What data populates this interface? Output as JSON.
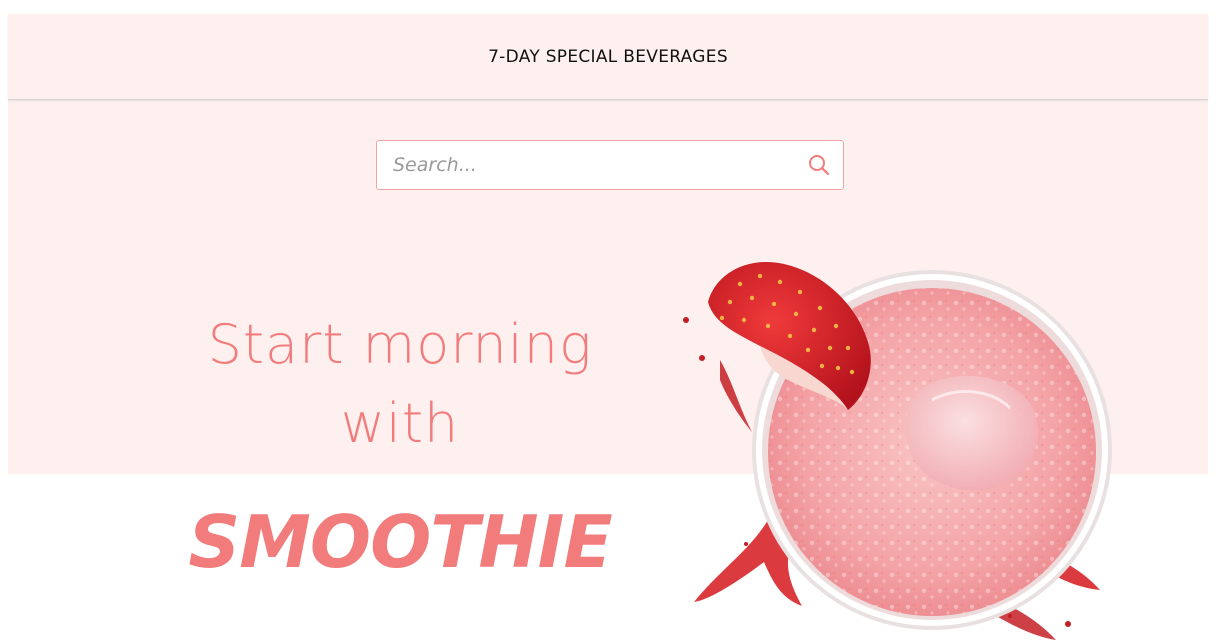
{
  "header": {
    "title": "7-DAY SPECIAL BEVERAGES"
  },
  "search": {
    "placeholder": "Search...",
    "value": "",
    "icon": "search-icon"
  },
  "hero": {
    "line1": "Start morning",
    "line2": "with",
    "line3": "SMOOTHIE",
    "image": "strawberry-smoothie-glass"
  },
  "colors": {
    "band_background": "#fff0f0",
    "accent": "#f27c7c",
    "search_border": "#f0a5a5"
  }
}
